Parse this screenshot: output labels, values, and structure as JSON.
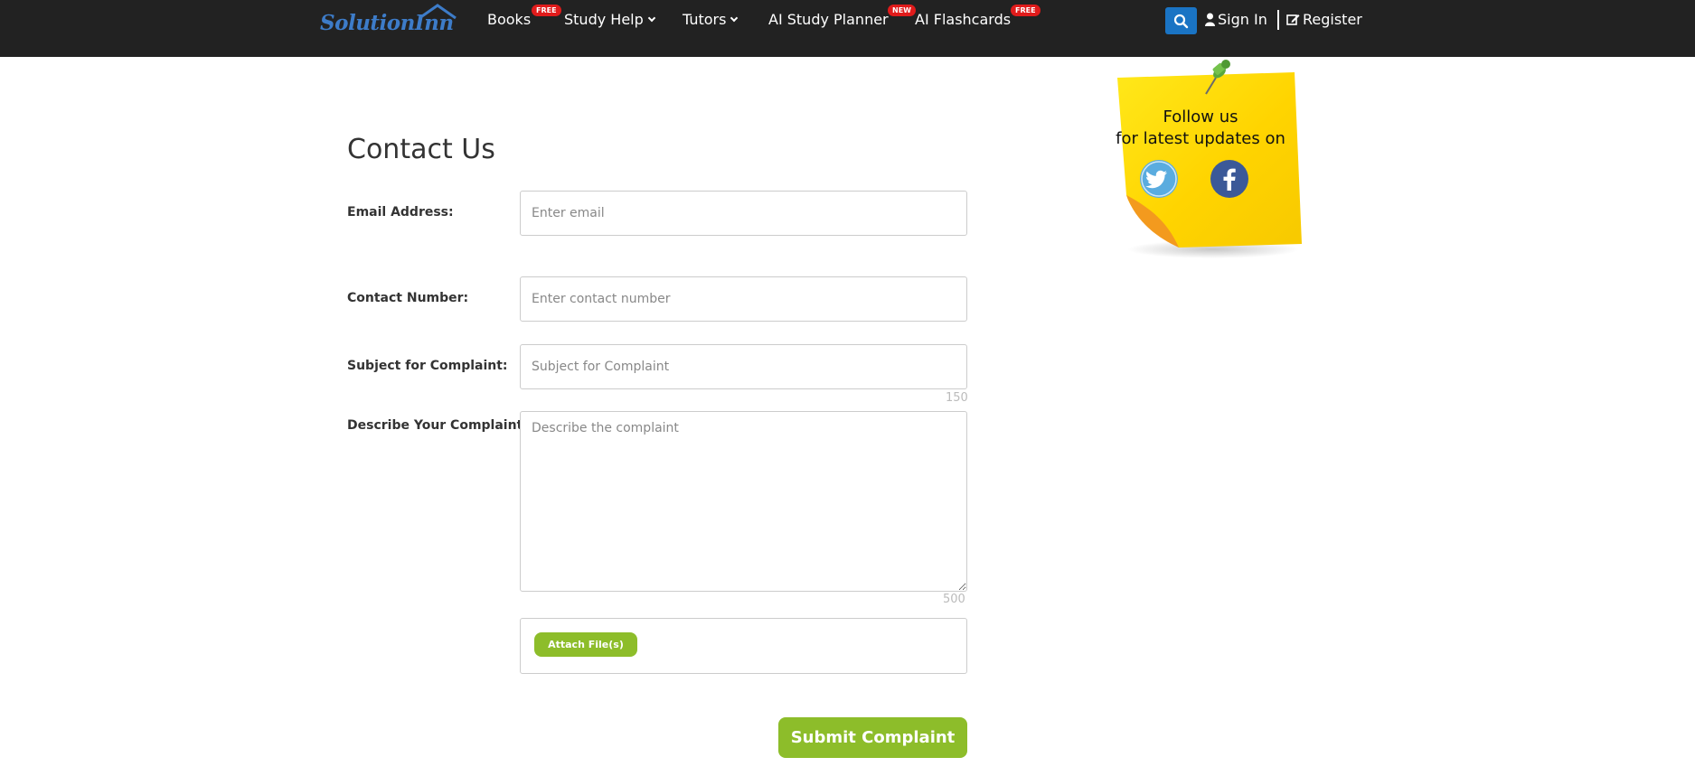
{
  "brand": {
    "logo_text": "SolutionInn",
    "logo_color": "#3d7cc9"
  },
  "nav": {
    "items": [
      {
        "label": "Books",
        "badge": "FREE",
        "dropdown": false
      },
      {
        "label": "Study Help",
        "badge": "",
        "dropdown": true
      },
      {
        "label": "Tutors",
        "badge": "",
        "dropdown": true
      },
      {
        "label": "AI Study Planner",
        "badge": "NEW",
        "dropdown": false
      },
      {
        "label": "AI Flashcards",
        "badge": "FREE",
        "dropdown": false
      }
    ],
    "sign_in": "Sign In",
    "register": "Register"
  },
  "form": {
    "title": "Contact Us",
    "email": {
      "label": "Email Address:",
      "placeholder": "Enter email"
    },
    "contact": {
      "label": "Contact Number:",
      "placeholder": "Enter contact number"
    },
    "subject": {
      "label": "Subject for Complaint:",
      "placeholder": "Subject for Complaint",
      "counter": "150"
    },
    "describe": {
      "label": "Describe Your Complaint:",
      "placeholder": "Describe the complaint",
      "counter": "500"
    },
    "attach_label": "Attach File(s)",
    "submit_label": "Submit Complaint"
  },
  "sticky": {
    "line1": "Follow us",
    "line2": "for latest updates on",
    "socials": [
      "twitter-icon",
      "facebook-icon"
    ]
  },
  "colors": {
    "navbar": "#222222",
    "accent_green": "#8dbd2a",
    "search_blue": "#1a74c4",
    "badge_red": "#e01b1b",
    "sticky_yellow": "#ffd600"
  }
}
